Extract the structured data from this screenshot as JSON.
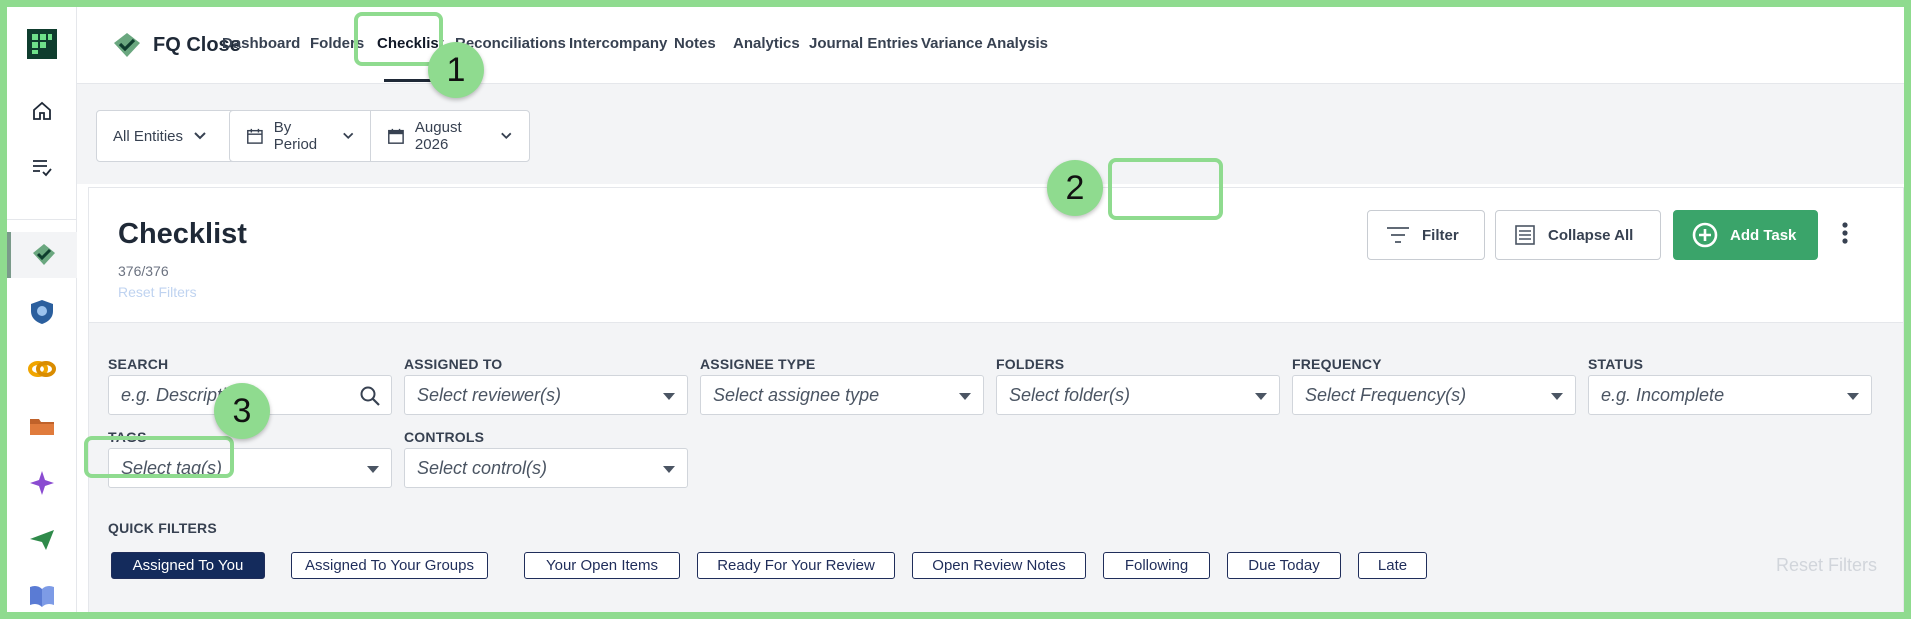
{
  "app": {
    "name": "FQ Close"
  },
  "nav": {
    "tabs": [
      "Dashboard",
      "Folders",
      "Checklist",
      "Reconciliations",
      "Intercompany",
      "Notes",
      "Analytics",
      "Journal Entries",
      "Variance Analysis"
    ],
    "active": "Checklist"
  },
  "period_bar": {
    "entities": "All Entities",
    "mode": "By Period",
    "period": "August 2026"
  },
  "panel": {
    "title": "Checklist",
    "count": "376/376",
    "reset_filters": "Reset Filters",
    "buttons": {
      "filter": "Filter",
      "collapse_all": "Collapse All",
      "add_task": "Add Task"
    }
  },
  "filters": {
    "search": {
      "label": "SEARCH",
      "placeholder": "e.g. Description"
    },
    "assigned_to": {
      "label": "ASSIGNED TO",
      "placeholder": "Select reviewer(s)"
    },
    "assignee_type": {
      "label": "ASSIGNEE TYPE",
      "placeholder": "Select assignee type"
    },
    "folders": {
      "label": "FOLDERS",
      "placeholder": "Select folder(s)"
    },
    "frequency": {
      "label": "FREQUENCY",
      "placeholder": "Select Frequency(s)"
    },
    "status": {
      "label": "STATUS",
      "placeholder": "e.g. Incomplete"
    },
    "tags": {
      "label": "TAGS",
      "placeholder": "Select tag(s)"
    },
    "controls": {
      "label": "CONTROLS",
      "placeholder": "Select control(s)"
    }
  },
  "quick_filters": {
    "label": "QUICK FILTERS",
    "items": [
      "Assigned To You",
      "Assigned To Your Groups",
      "Your Open Items",
      "Ready For Your Review",
      "Open Review Notes",
      "Following",
      "Due Today",
      "Late"
    ],
    "active": "Assigned To You",
    "reset": "Reset Filters"
  },
  "annotations": [
    "1",
    "2",
    "3"
  ],
  "colors": {
    "highlight": "#8fdb8f",
    "primary": "#3aa46a",
    "chip_active": "#142b5c"
  }
}
